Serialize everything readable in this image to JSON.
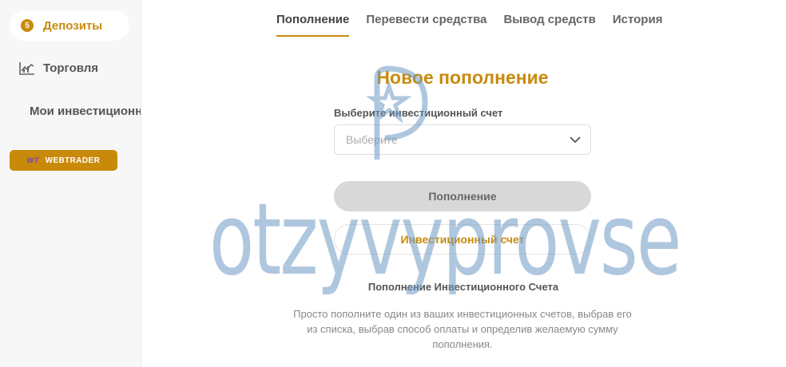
{
  "sidebar": {
    "items": [
      {
        "label": "Депозиты",
        "badge": "5",
        "icon": "badge-icon",
        "active": true
      },
      {
        "label": "Торговля",
        "icon": "trading-chart-icon",
        "active": false
      },
      {
        "label": "Мои инвестиционные",
        "active": false
      }
    ],
    "webtrader": {
      "logo": "WT",
      "label": "WEBTRADER"
    }
  },
  "tabs": [
    {
      "label": "Пополнение",
      "active": true
    },
    {
      "label": "Перевести средства",
      "active": false
    },
    {
      "label": "Вывод средств",
      "active": false
    },
    {
      "label": "История",
      "active": false
    }
  ],
  "form": {
    "title": "Новое пополнение",
    "account_label": "Выберите инвестиционный счет",
    "account_placeholder": "Выберите",
    "submit_label": "Пополнение",
    "secondary_label": "Инвестиционный счет"
  },
  "info": {
    "title": "Пополнение Инвестиционного Счета",
    "text": "Просто пополните один из ваших инвестиционных счетов, выбрав его из списка, выбрав способ оплаты и определив желаемую сумму пополнения."
  },
  "watermark": {
    "text": "otzyvyprovse"
  },
  "colors": {
    "accent": "#c98a0c",
    "watermark": "#6f9bc4"
  }
}
